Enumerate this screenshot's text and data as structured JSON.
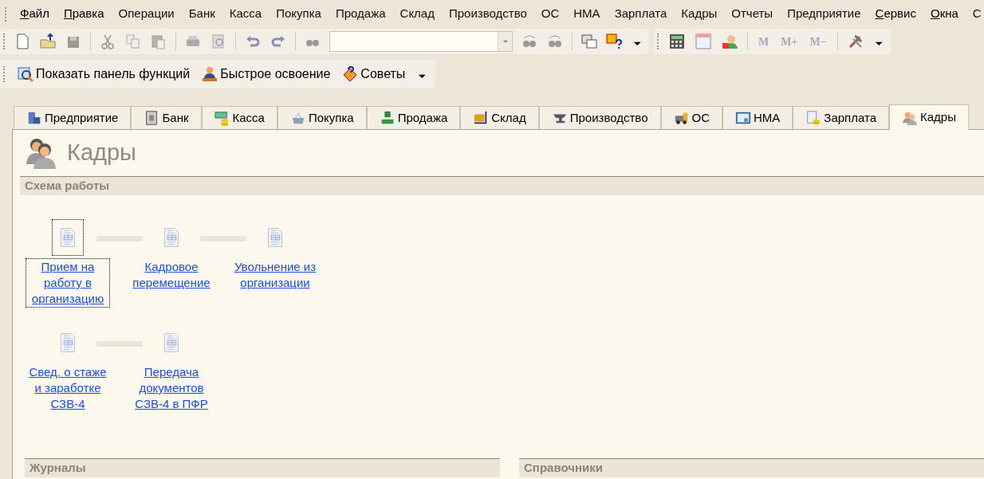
{
  "menu": [
    {
      "label": "Файл",
      "mnemonic": true
    },
    {
      "label": "Правка",
      "mnemonic": true
    },
    {
      "label": "Операции",
      "mnemonic": false
    },
    {
      "label": "Банк",
      "mnemonic": false
    },
    {
      "label": "Касса",
      "mnemonic": false
    },
    {
      "label": "Покупка",
      "mnemonic": false
    },
    {
      "label": "Продажа",
      "mnemonic": false
    },
    {
      "label": "Склад",
      "mnemonic": false
    },
    {
      "label": "Производство",
      "mnemonic": false
    },
    {
      "label": "ОС",
      "mnemonic": false
    },
    {
      "label": "НМА",
      "mnemonic": false
    },
    {
      "label": "Зарплата",
      "mnemonic": false
    },
    {
      "label": "Кадры",
      "mnemonic": false
    },
    {
      "label": "Отчеты",
      "mnemonic": false
    },
    {
      "label": "Предприятие",
      "mnemonic": false
    },
    {
      "label": "Сервис",
      "mnemonic": true
    },
    {
      "label": "Окна",
      "mnemonic": true
    },
    {
      "label": "С",
      "mnemonic": false
    }
  ],
  "memory_buttons": [
    "M",
    "M+",
    "M−"
  ],
  "function_buttons": [
    "Показать панель функций",
    "Быстрое освоение",
    "Советы"
  ],
  "tabs": [
    {
      "label": "Предприятие",
      "selected": false
    },
    {
      "label": "Банк",
      "selected": false
    },
    {
      "label": "Касса",
      "selected": false
    },
    {
      "label": "Покупка",
      "selected": false
    },
    {
      "label": "Продажа",
      "selected": false
    },
    {
      "label": "Склад",
      "selected": false
    },
    {
      "label": "Производство",
      "selected": false
    },
    {
      "label": "ОС",
      "selected": false
    },
    {
      "label": "НМА",
      "selected": false
    },
    {
      "label": "Зарплата",
      "selected": false
    },
    {
      "label": "Кадры",
      "selected": true
    }
  ],
  "page_title": "Кадры",
  "scheme": {
    "title": "Схема работы",
    "rows": [
      [
        {
          "label": "Прием на работу в организацию",
          "focused": true
        },
        {
          "label": "Кадровое перемещение",
          "focused": false
        },
        {
          "label": "Увольнение из организации",
          "focused": false
        }
      ],
      [
        {
          "label": "Свед. о стаже и заработке СЗВ-4",
          "focused": false
        },
        {
          "label": "Передача документов СЗВ-4 в ПФР",
          "focused": false
        }
      ]
    ]
  },
  "bottom_sections": [
    "Журналы",
    "Справочники"
  ]
}
